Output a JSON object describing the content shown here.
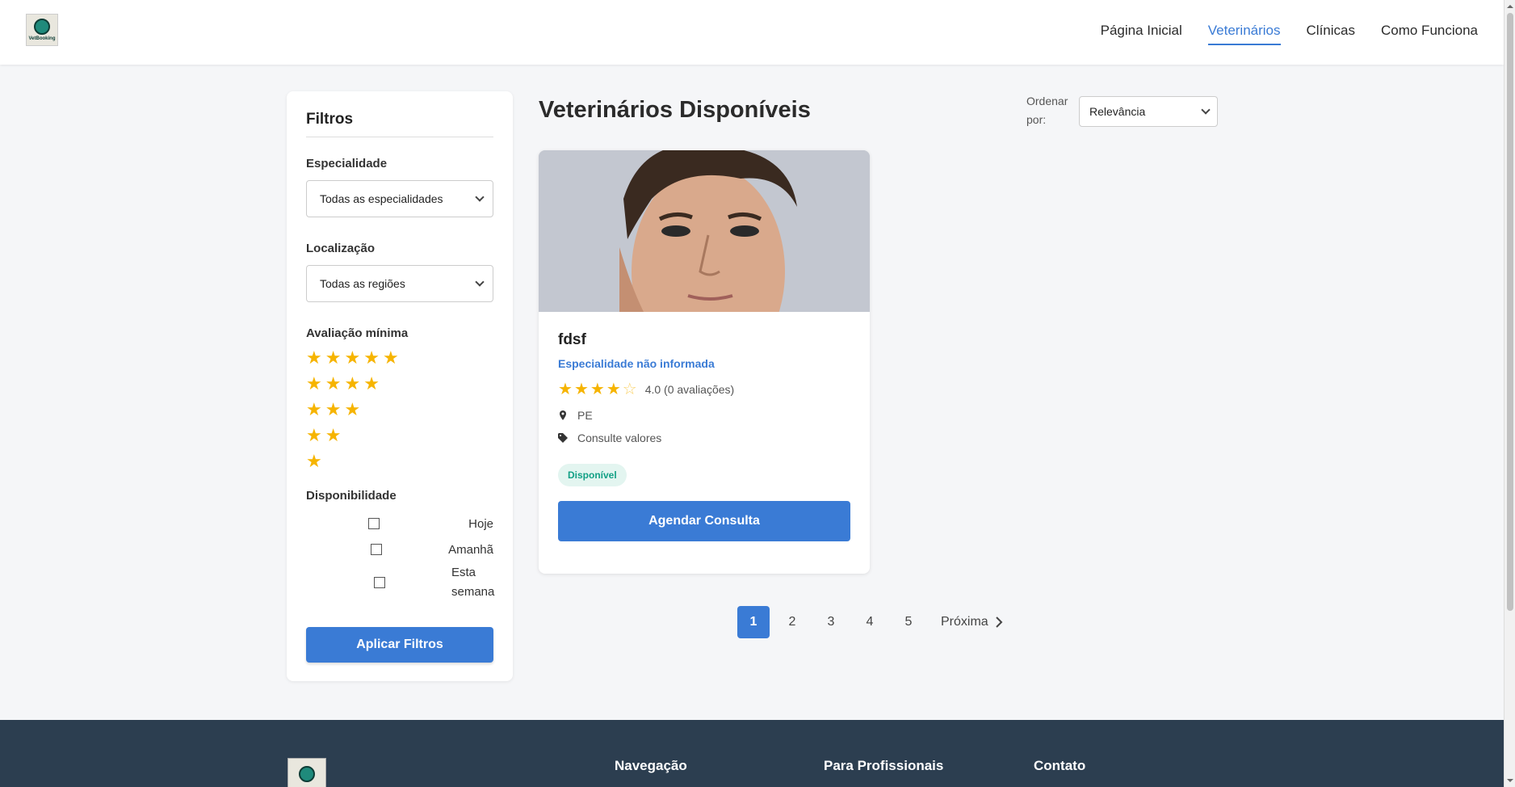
{
  "header": {
    "logo_text": "VetBooking",
    "nav": [
      "Página Inicial",
      "Veterinários",
      "Clínicas",
      "Como Funciona"
    ],
    "active_nav": "Veterinários"
  },
  "sidebar": {
    "title": "Filtros",
    "specialty": {
      "label": "Especialidade",
      "value": "Todas as especialidades"
    },
    "location": {
      "label": "Localização",
      "value": "Todas as regiões"
    },
    "rating": {
      "label": "Avaliação mínima",
      "options": [
        5,
        4,
        3,
        2,
        1
      ]
    },
    "availability": {
      "label": "Disponibilidade",
      "options": [
        "Hoje",
        "Amanhã",
        "Esta semana"
      ]
    },
    "apply_label": "Aplicar Filtros"
  },
  "main": {
    "title": "Veterinários Disponíveis",
    "sort_label": "Ordenar por:",
    "sort_value": "Relevância"
  },
  "vet_card": {
    "name": "fdsf",
    "specialty": "Especialidade não informada",
    "rating": 4.0,
    "rating_text": "4.0 (0 avaliações)",
    "location": "PE",
    "price": "Consulte valores",
    "status": "Disponível",
    "book_label": "Agendar Consulta"
  },
  "pagination": {
    "pages": [
      "1",
      "2",
      "3",
      "4",
      "5"
    ],
    "current": "1",
    "next_label": "Próxima"
  },
  "footer": {
    "columns": [
      "Navegação",
      "Para Profissionais",
      "Contato"
    ]
  },
  "colors": {
    "primary": "#3a7bd5",
    "star": "#f6b400",
    "footer_bg": "#2c3e50",
    "badge_bg": "#e3f5f0",
    "badge_text": "#12a085"
  }
}
